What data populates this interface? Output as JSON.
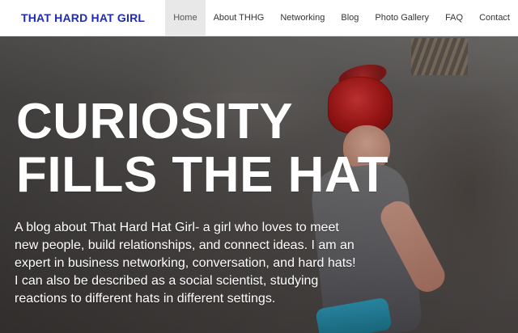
{
  "header": {
    "brand": "THAT HARD HAT GIRL",
    "nav": [
      {
        "label": "Home",
        "active": true
      },
      {
        "label": "About THHG",
        "active": false
      },
      {
        "label": "Networking",
        "active": false
      },
      {
        "label": "Blog",
        "active": false
      },
      {
        "label": "Photo Gallery",
        "active": false
      },
      {
        "label": "FAQ",
        "active": false
      },
      {
        "label": "Contact",
        "active": false
      }
    ]
  },
  "hero": {
    "headline_line1": "CURIOSITY",
    "headline_line2": "FILLS THE HAT",
    "blurb": "A blog about That Hard Hat Girl- a girl who loves to meet new people, build relationships, and connect ideas. I am an expert in business networking, conversation, and hard hats! I can also be described as a social scientist, studying reactions to different hats in different settings."
  },
  "colors": {
    "brand": "#1f2bb5",
    "nav_active_bg": "#e8e8e8",
    "nav_text": "#333333",
    "hero_text": "#ffffff"
  }
}
